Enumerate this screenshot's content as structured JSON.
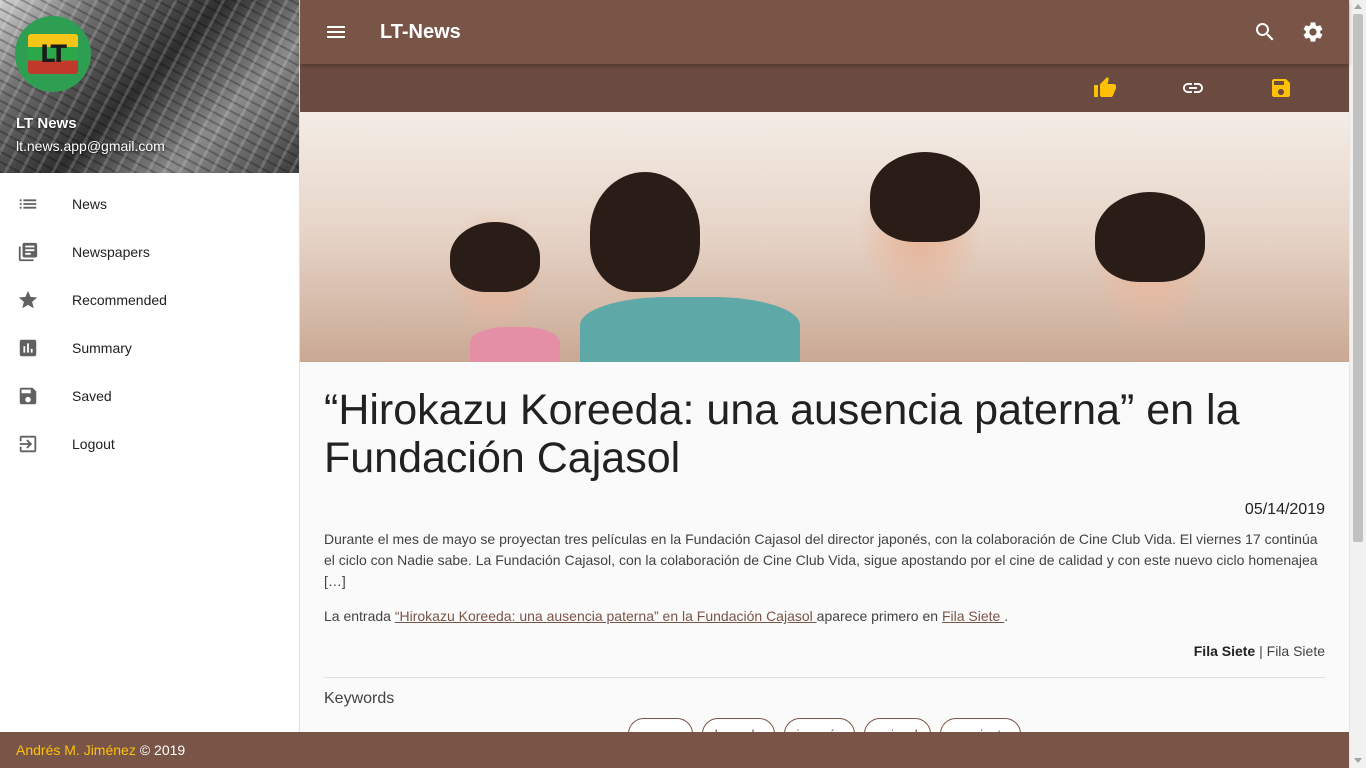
{
  "sidebar": {
    "user_name": "LT News",
    "user_email": "lt.news.app@gmail.com",
    "logo_text": "LT",
    "items": [
      {
        "label": "News",
        "icon": "list-icon"
      },
      {
        "label": "Newspapers",
        "icon": "newspapers-icon"
      },
      {
        "label": "Recommended",
        "icon": "star-icon"
      },
      {
        "label": "Summary",
        "icon": "bar-chart-icon"
      },
      {
        "label": "Saved",
        "icon": "save-icon"
      },
      {
        "label": "Logout",
        "icon": "logout-icon"
      }
    ]
  },
  "header": {
    "title": "LT-News",
    "icons": [
      "menu-icon",
      "search-icon",
      "settings-icon"
    ]
  },
  "actions": {
    "icons": [
      "thumb-up-icon",
      "link-icon",
      "save-icon"
    ]
  },
  "article": {
    "headline": "“Hirokazu Koreeda: una ausencia paterna” en la Fundación Cajasol",
    "date": "05/14/2019",
    "summary": "Durante el mes de mayo se proyectan tres películas en la Fundación Cajasol del director japonés, con la colaboración de Cine Club Vida. El viernes 17 continúa el ciclo con Nadie sabe. La Fundación Cajasol, con la colaboración de Cine Club Vida, sigue apostando por el cine de calidad y con este nuevo ciclo homenajea […]",
    "entry_prefix": "La entrada ",
    "entry_link": "“Hirokazu Koreeda: una ausencia paterna” en la Fundación Cajasol ",
    "entry_middle": "aparece primero en ",
    "entry_site": "Fila Siete ",
    "entry_suffix": ".",
    "source_name": "Fila Siete",
    "source_separator": " | ",
    "source_site": "Fila Siete",
    "keywords_title": "Keywords",
    "keywords": [
      "osamu",
      "koreeda",
      "japonés",
      "cajasol",
      "asesinato"
    ]
  },
  "footer": {
    "author": "Andrés M. Jiménez",
    "copyright": "© 2019"
  },
  "colors": {
    "primary": "#795548",
    "primary_dark": "#6b4a3f",
    "accent": "#ffc107"
  }
}
